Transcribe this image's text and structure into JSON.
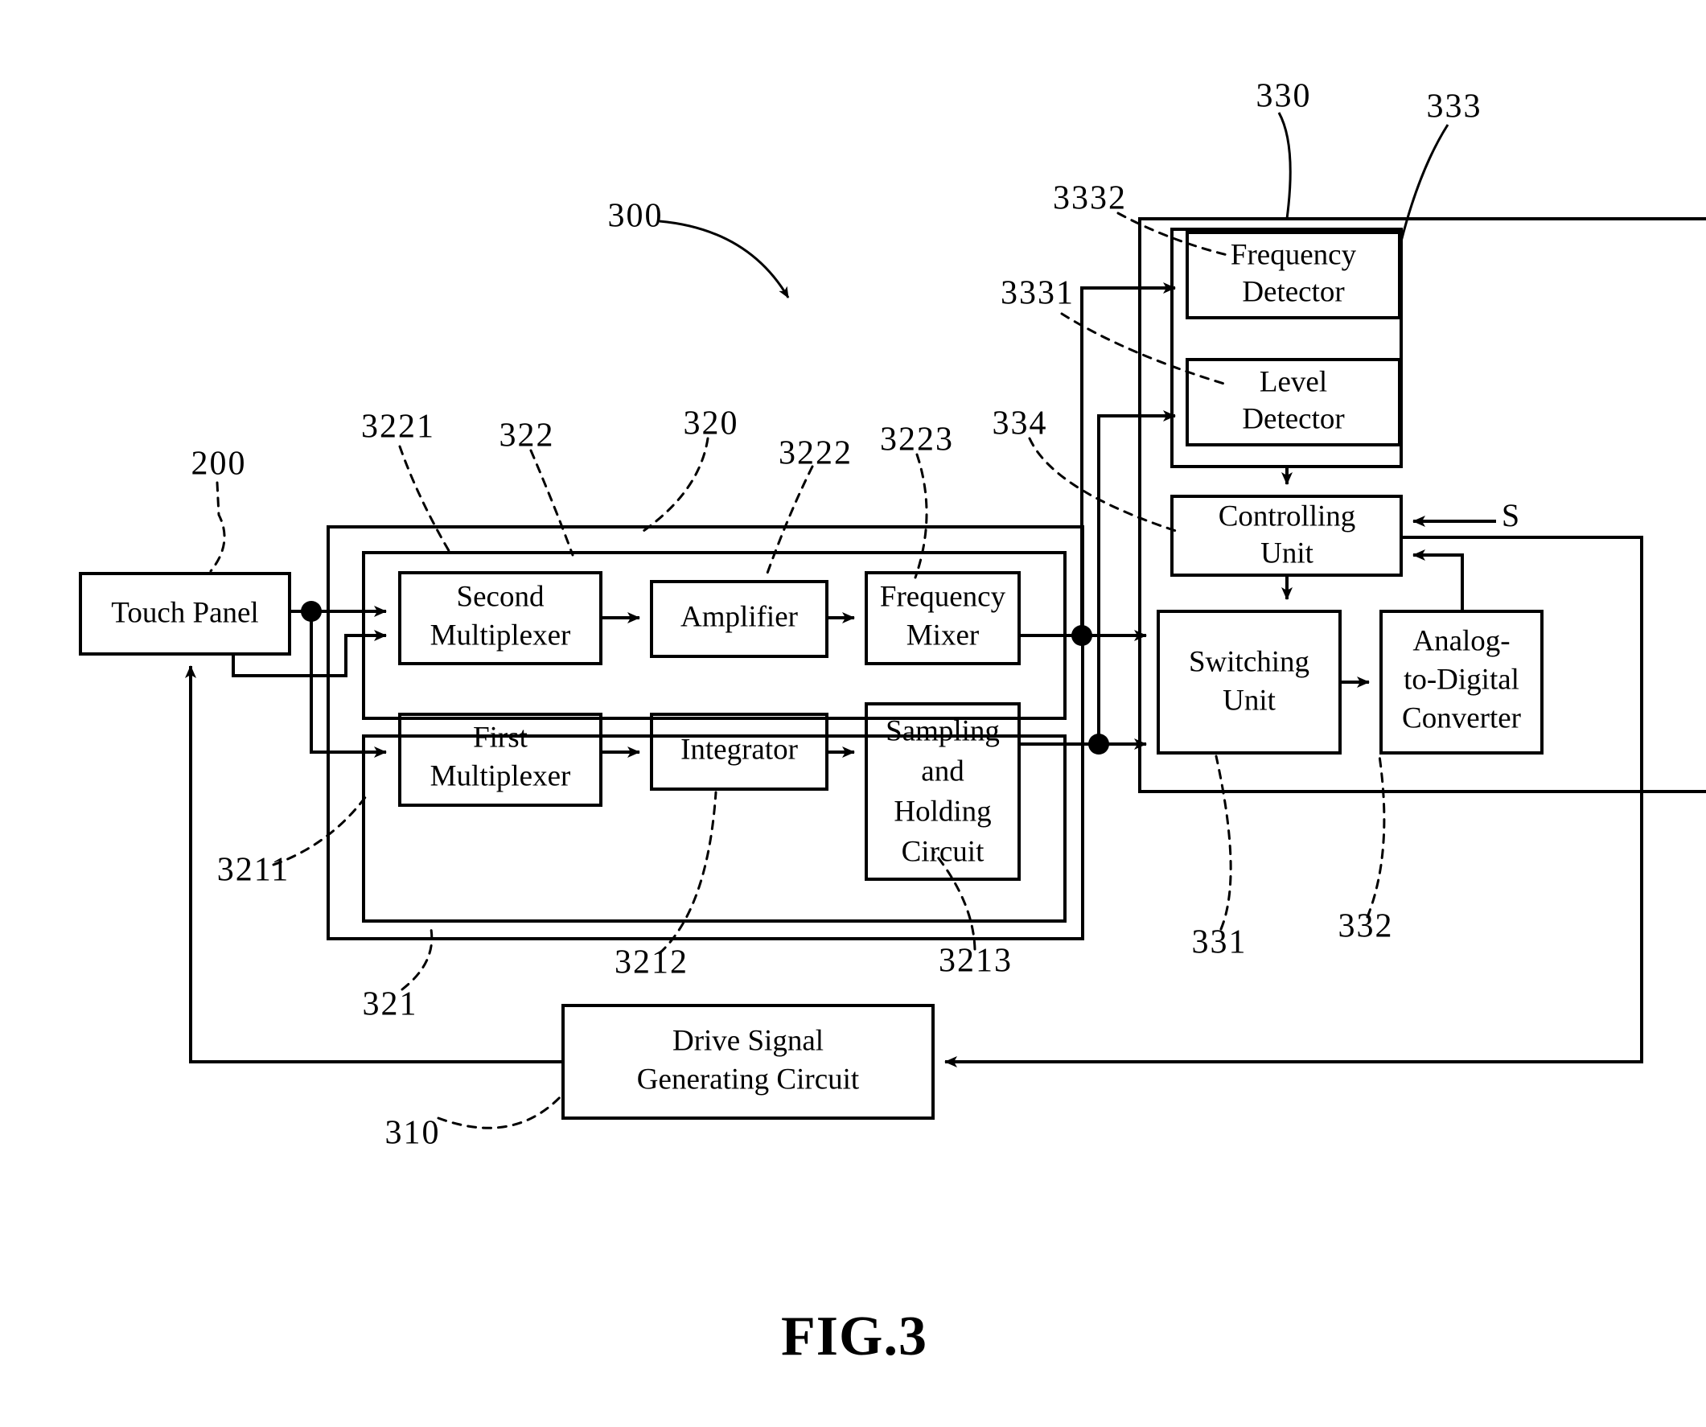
{
  "figure": {
    "caption": "FIG.3",
    "signal_input_label": "S"
  },
  "blocks": {
    "touch_panel": {
      "label": "Touch Panel",
      "ref": "200"
    },
    "second_multiplexer": {
      "label_line1": "Second",
      "label_line2": "Multiplexer",
      "ref": "3221"
    },
    "amplifier": {
      "label": "Amplifier",
      "ref": "3222"
    },
    "frequency_mixer": {
      "label_line1": "Frequency",
      "label_line2": "Mixer",
      "ref": "3223"
    },
    "first_multiplexer": {
      "label_line1": "First",
      "label_line2": "Multiplexer",
      "ref": "3211"
    },
    "integrator": {
      "label": "Integrator",
      "ref": "3212"
    },
    "sampling_holding_circuit": {
      "label_line1": "Sampling",
      "label_line2": "and",
      "label_line3": "Holding",
      "label_line4": "Circuit",
      "ref": "3213"
    },
    "frequency_detector": {
      "label_line1": "Frequency",
      "label_line2": "Detector",
      "ref": "3332"
    },
    "level_detector": {
      "label_line1": "Level",
      "label_line2": "Detector",
      "ref": "3331"
    },
    "controlling_unit": {
      "label_line1": "Controlling",
      "label_line2": "Unit",
      "ref": "334"
    },
    "switching_unit": {
      "label_line1": "Switching",
      "label_line2": "Unit",
      "ref": "331"
    },
    "analog_to_digital_converter": {
      "label_line1": "Analog-",
      "label_line2": "to-Digital",
      "label_line3": "Converter",
      "ref": "332"
    },
    "drive_signal_generating_circuit": {
      "label_line1": "Drive Signal",
      "label_line2": "Generating Circuit",
      "ref": "310"
    }
  },
  "groups": {
    "sensing_circuit": {
      "ref": "320"
    },
    "second_sensing_path": {
      "ref": "322"
    },
    "first_sensing_path": {
      "ref": "321"
    },
    "processing_unit": {
      "ref": "330"
    },
    "detector_group": {
      "ref": "333"
    },
    "system": {
      "ref": "300"
    }
  },
  "reference_numerals": {
    "n200": "200",
    "n300": "300",
    "n310": "310",
    "n320": "320",
    "n321": "321",
    "n322": "322",
    "n330": "330",
    "n331": "331",
    "n332": "332",
    "n333": "333",
    "n334": "334",
    "n3211": "3211",
    "n3212": "3212",
    "n3213": "3213",
    "n3221": "3221",
    "n3222": "3222",
    "n3223": "3223",
    "n3331": "3331",
    "n3332": "3332"
  }
}
